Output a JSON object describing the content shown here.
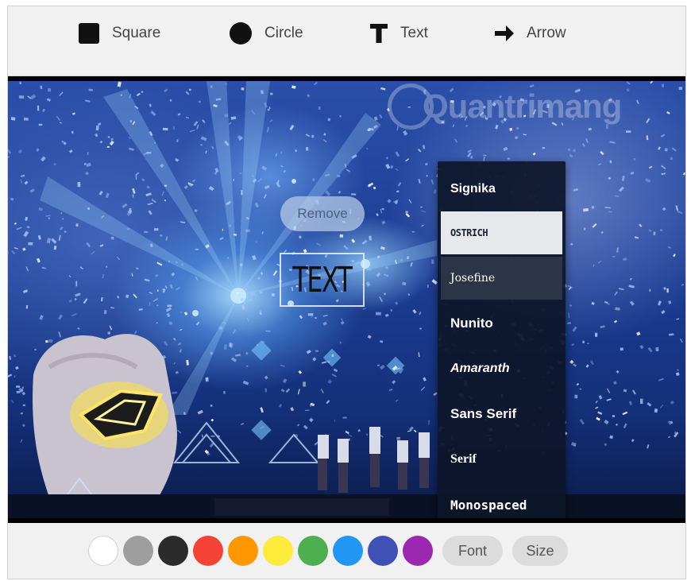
{
  "toolbar": {
    "tools": [
      {
        "label": "Square",
        "icon": "square-icon"
      },
      {
        "label": "Circle",
        "icon": "circle-icon"
      },
      {
        "label": "Text",
        "icon": "text-T-icon"
      },
      {
        "label": "Arrow",
        "icon": "arrow-right-icon"
      }
    ]
  },
  "canvas": {
    "watermark": "Quantrimang",
    "remove_label": "Remove",
    "text_annotation": "TEXT"
  },
  "font_menu": {
    "selected": "OSTRICH",
    "items": [
      "Signika",
      "OSTRICH",
      "Josefine",
      "Nunito",
      "Amaranth",
      "Sans Serif",
      "Serif",
      "Monospaced"
    ]
  },
  "bottom_bar": {
    "colors": [
      "#ffffff",
      "#9e9e9e",
      "#2b2b2b",
      "#f44336",
      "#ff9800",
      "#ffeb3b",
      "#4caf50",
      "#2196f3",
      "#3f51b5",
      "#9c27b0"
    ],
    "font_label": "Font",
    "size_label": "Size"
  }
}
